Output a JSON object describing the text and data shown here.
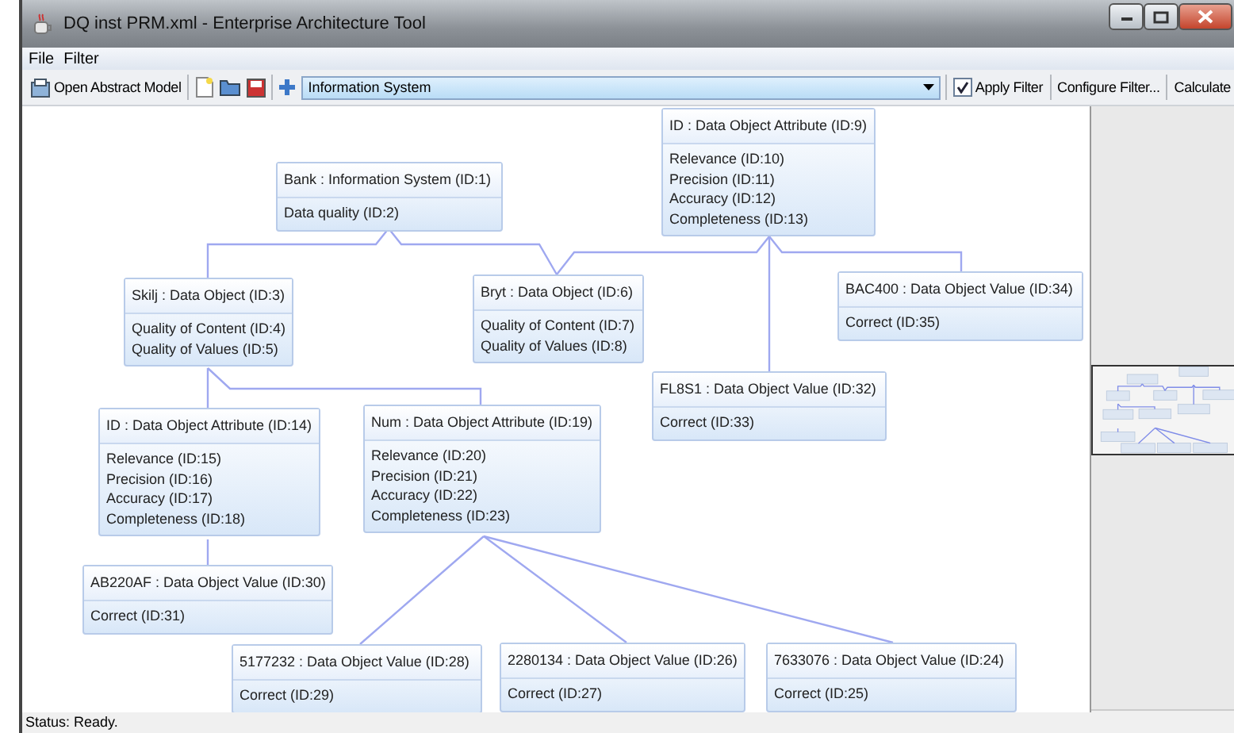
{
  "window": {
    "title": "DQ inst PRM.xml - Enterprise Architecture Tool"
  },
  "menu": [
    "File",
    "Filter"
  ],
  "toolbar": {
    "open_button": "Open Abstract Model",
    "combo": {
      "value": "Information System"
    },
    "apply_filter": {
      "label": "Apply Filter",
      "checked": true
    },
    "configure_button": "Configure Filter...",
    "calculate_button": "Calculate"
  },
  "nodes": [
    {
      "title": "Bank : Information System (ID:1)",
      "items": [
        "Data quality (ID:2)"
      ]
    },
    {
      "title": "ID : Data Object Attribute (ID:9)",
      "items": [
        "Relevance (ID:10)",
        "Precision (ID:11)",
        "Accuracy (ID:12)",
        "Completeness (ID:13)"
      ]
    },
    {
      "title": "Skilj : Data Object (ID:3)",
      "items": [
        "Quality of Content (ID:4)",
        "Quality of Values (ID:5)"
      ]
    },
    {
      "title": "Bryt : Data Object (ID:6)",
      "items": [
        "Quality of Content (ID:7)",
        "Quality of Values (ID:8)"
      ]
    },
    {
      "title": "BAC400 : Data Object Value (ID:34)",
      "items": [
        "Correct (ID:35)"
      ]
    },
    {
      "title": "FL8S1 : Data Object Value (ID:32)",
      "items": [
        "Correct (ID:33)"
      ]
    },
    {
      "title": "ID : Data Object Attribute (ID:14)",
      "items": [
        "Relevance (ID:15)",
        "Precision (ID:16)",
        "Accuracy (ID:17)",
        "Completeness (ID:18)"
      ]
    },
    {
      "title": "Num : Data Object Attribute (ID:19)",
      "items": [
        "Relevance (ID:20)",
        "Precision (ID:21)",
        "Accuracy (ID:22)",
        "Completeness (ID:23)"
      ]
    },
    {
      "title": "AB220AF : Data Object Value (ID:30)",
      "items": [
        "Correct (ID:31)"
      ]
    },
    {
      "title": "5177232 : Data Object Value (ID:28)",
      "items": [
        "Correct (ID:29)"
      ]
    },
    {
      "title": "2280134 : Data Object Value (ID:26)",
      "items": [
        "Correct (ID:27)"
      ]
    },
    {
      "title": "7633076 : Data Object Value (ID:24)",
      "items": [
        "Correct (ID:25)"
      ]
    }
  ],
  "status_bar": "Status: Ready."
}
